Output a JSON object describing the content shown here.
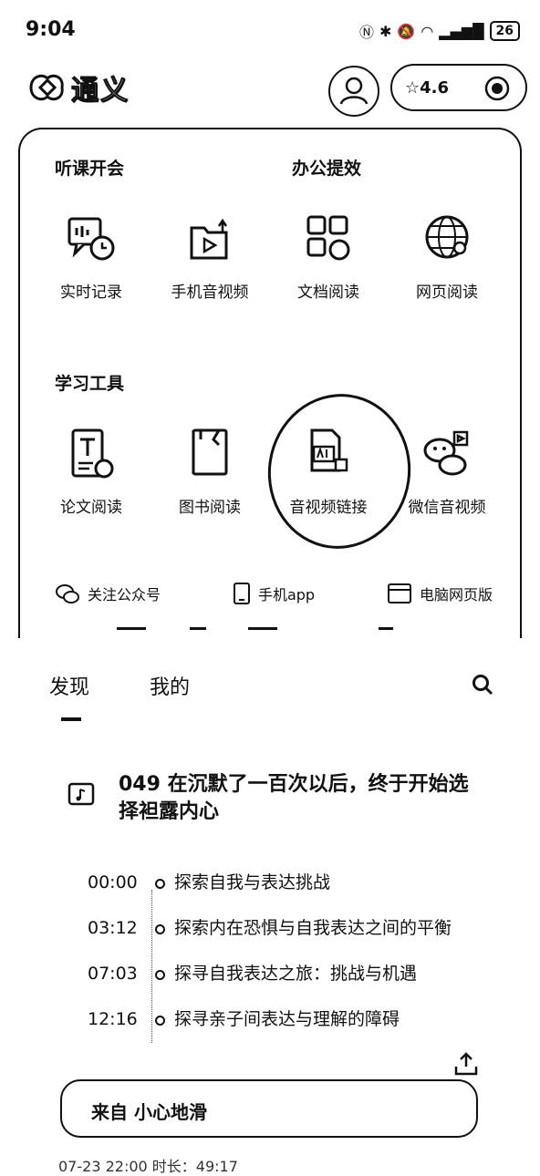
{
  "status_bar": {
    "time": "9:04",
    "battery": "26"
  },
  "header": {
    "app_name": "通义",
    "rating": "4.6"
  },
  "sections": {
    "listen": "听课开会",
    "office": "办公提效",
    "study": "学习工具"
  },
  "tools_row1": [
    {
      "label": "实时记录",
      "icon": "realtime-record-icon"
    },
    {
      "label": "手机音视频",
      "icon": "phone-media-icon"
    },
    {
      "label": "文档阅读",
      "icon": "document-read-icon"
    },
    {
      "label": "网页阅读",
      "icon": "web-read-icon"
    }
  ],
  "tools_row2": [
    {
      "label": "论文阅读",
      "icon": "paper-read-icon"
    },
    {
      "label": "图书阅读",
      "icon": "book-read-icon"
    },
    {
      "label": "音视频链接",
      "icon": "media-link-icon"
    },
    {
      "label": "微信音视频",
      "icon": "wechat-media-icon"
    }
  ],
  "links": [
    {
      "label": "关注公众号",
      "icon": "wechat-icon"
    },
    {
      "label": "手机app",
      "icon": "phone-icon"
    },
    {
      "label": "电脑网页版",
      "icon": "browser-icon"
    }
  ],
  "tabs": {
    "discover": "发现",
    "mine": "我的"
  },
  "article": {
    "title": "049 在沉默了一百次以后，终于开始选择袒露内心",
    "chapters": [
      {
        "time": "00:00",
        "text": "探索自我与表达挑战"
      },
      {
        "time": "03:12",
        "text": "探索内在恐惧与自我表达之间的平衡"
      },
      {
        "time": "07:03",
        "text": "探寻自我表达之旅：挑战与机遇"
      },
      {
        "time": "12:16",
        "text": "探寻亲子间表达与理解的障碍"
      }
    ],
    "source": "来自 小心地滑",
    "meta": "07-23 22:00    时长：49:17"
  }
}
